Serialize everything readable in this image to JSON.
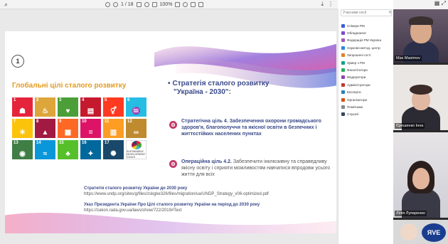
{
  "viewer": {
    "page_indicator": "1 / 18",
    "zoom": "100%"
  },
  "slide": {
    "number": "1",
    "sdg_title": "Глобальні цілі сталого розвитку",
    "strategy_heading_line1": "Стратегія сталого розвитку",
    "strategy_heading_line2": "\"Україна - 2030\":",
    "goal_text": "Стратегічна ціль 4. Забезпечення охорони громадського здоров'я, благополуччя та якісної освіти в безпечних і життєстійких населених пунктах",
    "task_label": "Операційна ціль 4.2.",
    "task_text": " Забезпечити інклюзивну та справедливу якісну освіту і сприяти можливостям навчатися впродовж усього життя для всіх",
    "link1_title": "Стратегія сталого розвитку України до 2030 року",
    "link1_url": "https://www.undp.org/sites/g/files/zskgke326/files/migration/ua/UNDP_Strategy_v06-optimized.pdf",
    "link2_title": "Указ Президента України Про Цілі сталого розвитку України на період до 2030 року",
    "link2_url": "https://zakon.rada.gov.ua/laws/show/722/2019#Text",
    "sdg_logo_text": "SUSTAINABLE DEVELOPMENT GOALS"
  },
  "sdg_tiles": [
    {
      "n": "1",
      "color": "#e5243b",
      "icon": "people-icon",
      "glyph": "☗"
    },
    {
      "n": "2",
      "color": "#dda63a",
      "icon": "bowl-icon",
      "glyph": "♨"
    },
    {
      "n": "3",
      "color": "#4c9f38",
      "icon": "heartbeat-icon",
      "glyph": "♥"
    },
    {
      "n": "4",
      "color": "#c5192d",
      "icon": "book-icon",
      "glyph": "▤"
    },
    {
      "n": "5",
      "color": "#ff3a21",
      "icon": "gender-icon",
      "glyph": "⚥"
    },
    {
      "n": "6",
      "color": "#26bde2",
      "icon": "water-icon",
      "glyph": "♒"
    },
    {
      "n": "7",
      "color": "#fcc30b",
      "icon": "sun-icon",
      "glyph": "☀"
    },
    {
      "n": "8",
      "color": "#a21942",
      "icon": "growth-icon",
      "glyph": "▲"
    },
    {
      "n": "9",
      "color": "#fd6925",
      "icon": "cubes-icon",
      "glyph": "▦"
    },
    {
      "n": "10",
      "color": "#dd1367",
      "icon": "equal-icon",
      "glyph": "="
    },
    {
      "n": "11",
      "color": "#fd9d24",
      "icon": "buildings-icon",
      "glyph": "▥"
    },
    {
      "n": "12",
      "color": "#bf8b2e",
      "icon": "infinity-icon",
      "glyph": "∞"
    },
    {
      "n": "13",
      "color": "#3f7e44",
      "icon": "eye-icon",
      "glyph": "◉"
    },
    {
      "n": "14",
      "color": "#0a97d9",
      "icon": "fish-icon",
      "glyph": "≈"
    },
    {
      "n": "15",
      "color": "#56c02b",
      "icon": "tree-icon",
      "glyph": "♣"
    },
    {
      "n": "16",
      "color": "#00689d",
      "icon": "dove-icon",
      "glyph": "✦"
    },
    {
      "n": "17",
      "color": "#19486a",
      "icon": "network-icon",
      "glyph": "✺"
    }
  ],
  "participants_panel": {
    "search_placeholder": "Учасники сесії",
    "items": [
      {
        "label": "Спікери РМ",
        "color": "#3a5bd9"
      },
      {
        "label": "Обладнання",
        "color": "#7a4bd1"
      },
      {
        "label": "Федерація РМ Україна",
        "color": "#9b59b6"
      },
      {
        "label": "Науково-метод. центр",
        "color": "#2e86de"
      },
      {
        "label": "Запрошені гості",
        "color": "#e67e22"
      },
      {
        "label": "Зумер з РМ",
        "color": "#16a085"
      },
      {
        "label": "Фасилітатори",
        "color": "#27ae60"
      },
      {
        "label": "Модератори",
        "color": "#8e44ad"
      },
      {
        "label": "Адміністратори",
        "color": "#c0392b"
      },
      {
        "label": "Експерти",
        "color": "#2980b9"
      },
      {
        "label": "Організатори",
        "color": "#d35400"
      },
      {
        "label": "Помічники",
        "color": "#7f8c8d"
      },
      {
        "label": "Слухачі",
        "color": "#34495e"
      }
    ]
  },
  "video_tiles": [
    {
      "name": "Max Maximov"
    },
    {
      "name": "Єрешенко Інна"
    },
    {
      "name": "Лілія Лупаренко"
    },
    {
      "name": "ЯVЕ"
    }
  ]
}
